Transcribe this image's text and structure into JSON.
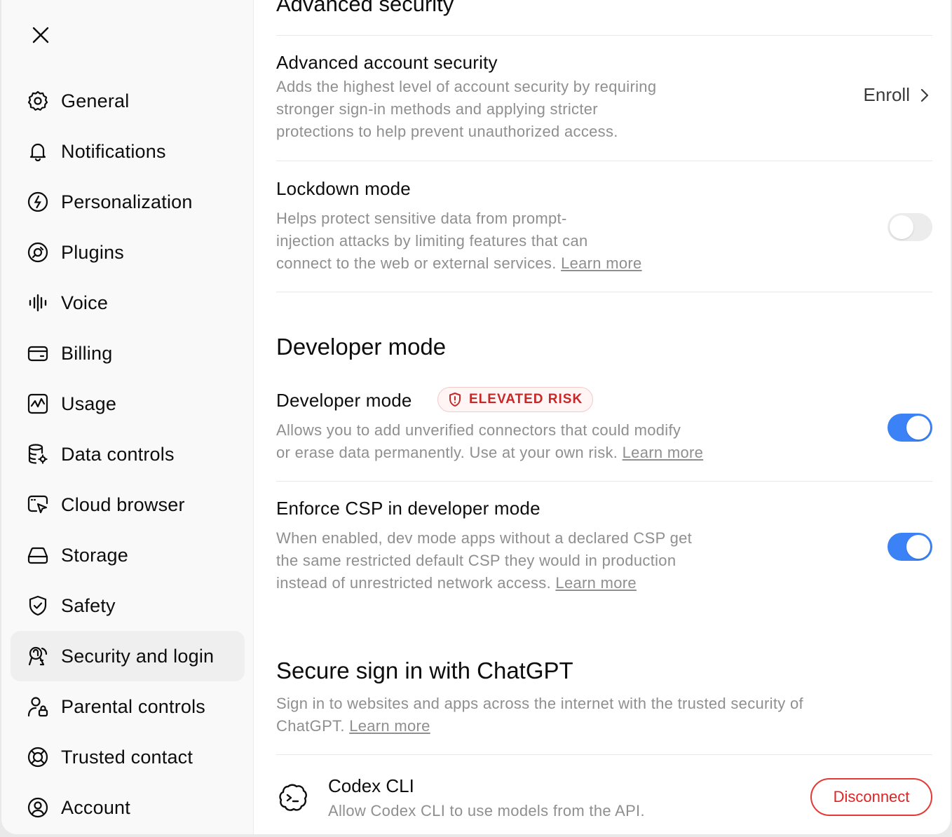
{
  "sidebar": {
    "items": [
      {
        "label": "General",
        "icon": "gear-icon"
      },
      {
        "label": "Notifications",
        "icon": "bell-icon"
      },
      {
        "label": "Personalization",
        "icon": "personalization-icon"
      },
      {
        "label": "Plugins",
        "icon": "plugins-icon"
      },
      {
        "label": "Voice",
        "icon": "voice-waveform-icon"
      },
      {
        "label": "Billing",
        "icon": "card-icon"
      },
      {
        "label": "Usage",
        "icon": "usage-chart-icon"
      },
      {
        "label": "Data controls",
        "icon": "database-gear-icon"
      },
      {
        "label": "Cloud browser",
        "icon": "cloud-browser-icon"
      },
      {
        "label": "Storage",
        "icon": "storage-drive-icon"
      },
      {
        "label": "Safety",
        "icon": "shield-check-icon"
      },
      {
        "label": "Security and login",
        "icon": "security-login-icon",
        "active": true
      },
      {
        "label": "Parental controls",
        "icon": "parental-lock-icon"
      },
      {
        "label": "Trusted contact",
        "icon": "lifebuoy-icon"
      },
      {
        "label": "Account",
        "icon": "account-circle-icon"
      }
    ]
  },
  "main": {
    "advanced_security_title": "Advanced security",
    "advanced_account": {
      "title": "Advanced account security",
      "desc_lines": [
        "Adds the highest level of account security by requiring",
        "stronger sign-in methods and applying stricter",
        "protections to help prevent unauthorized access."
      ],
      "action": "Enroll"
    },
    "lockdown": {
      "title": "Lockdown mode",
      "desc_lines": [
        "Helps protect sensitive data from prompt-",
        "injection attacks by limiting features that can",
        "connect to the web or external services."
      ],
      "link": "Learn more",
      "enabled": false
    },
    "developer_section_title": "Developer mode",
    "developer_mode": {
      "title": "Developer mode",
      "badge": "ELEVATED RISK",
      "desc_lines": [
        "Allows you to add unverified connectors that could modify",
        "or erase data permanently. Use at your own risk."
      ],
      "link": "Learn more",
      "enabled": true
    },
    "enforce_csp": {
      "title": "Enforce CSP in developer mode",
      "desc_lines": [
        "When enabled, dev mode apps without a declared CSP get",
        "the same restricted default CSP they would in production",
        "instead of unrestricted network access."
      ],
      "link": "Learn more",
      "enabled": true
    },
    "secure_signin": {
      "title": "Secure sign in with ChatGPT",
      "desc_lines": [
        "Sign in to websites and apps across the internet with the trusted security of",
        "ChatGPT."
      ],
      "link": "Learn more"
    },
    "codex": {
      "title": "Codex CLI",
      "desc": "Allow Codex CLI to use models from the API.",
      "action": "Disconnect"
    }
  },
  "colors": {
    "accent_blue": "#3b82f6",
    "danger_red": "#e02424",
    "muted_text": "#8f8f8f"
  }
}
